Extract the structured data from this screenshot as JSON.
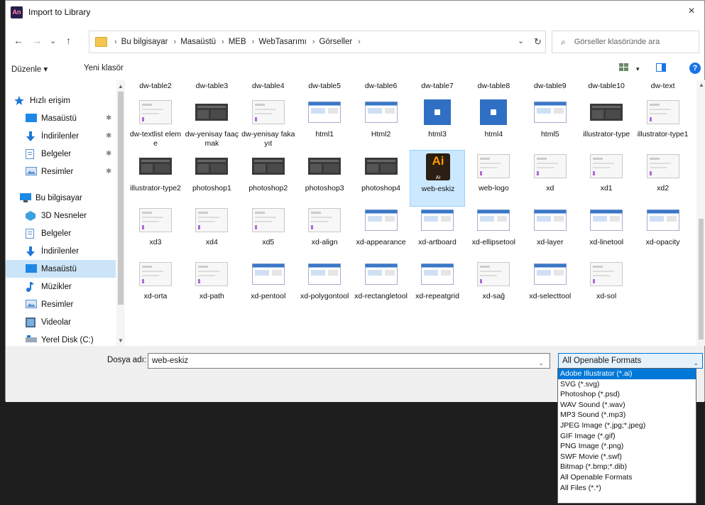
{
  "window": {
    "title": "Import to Library",
    "app_icon": "An",
    "close_label": "×"
  },
  "nav": {
    "back": "←",
    "forward": "→",
    "recent": "⌄",
    "up": "↑"
  },
  "address": {
    "crumbs": [
      "Bu bilgisayar",
      "Masaüstü",
      "MEB",
      "WebTasarımı",
      "Görseller"
    ],
    "separator": "›",
    "dropdown": "⌄",
    "refresh": "↻"
  },
  "search": {
    "icon": "⌕",
    "placeholder": "Görseller klasöründe ara"
  },
  "toolbar": {
    "organize": "Düzenle ▾",
    "new_folder": "Yeni klasör",
    "view_dropdown": "▾",
    "help": "?"
  },
  "sidebar": {
    "items": [
      {
        "label": "Hızlı erişim",
        "icon": "star-icon",
        "pinned": false,
        "selected": false
      },
      {
        "label": "Masaüstü",
        "icon": "desktop-icon",
        "pinned": true,
        "selected": false
      },
      {
        "label": "İndirilenler",
        "icon": "download-icon",
        "pinned": true,
        "selected": false
      },
      {
        "label": "Belgeler",
        "icon": "document-icon",
        "pinned": true,
        "selected": false
      },
      {
        "label": "Resimler",
        "icon": "pictures-icon",
        "pinned": true,
        "selected": false
      },
      {
        "label": "Bu bilgisayar",
        "icon": "computer-icon",
        "pinned": false,
        "selected": false
      },
      {
        "label": "3D Nesneler",
        "icon": "3d-objects-icon",
        "pinned": false,
        "selected": false
      },
      {
        "label": "Belgeler",
        "icon": "document-icon",
        "pinned": false,
        "selected": false
      },
      {
        "label": "İndirilenler",
        "icon": "download-icon",
        "pinned": false,
        "selected": false
      },
      {
        "label": "Masaüstü",
        "icon": "desktop-icon",
        "pinned": false,
        "selected": true
      },
      {
        "label": "Müzikler",
        "icon": "music-icon",
        "pinned": false,
        "selected": false
      },
      {
        "label": "Resimler",
        "icon": "pictures-icon",
        "pinned": false,
        "selected": false
      },
      {
        "label": "Videolar",
        "icon": "video-icon",
        "pinned": false,
        "selected": false
      },
      {
        "label": "Yerel Disk (C:)",
        "icon": "disk-icon",
        "pinned": false,
        "selected": false
      }
    ]
  },
  "files": {
    "top_row": [
      "dw-table2",
      "dw-table3",
      "dw-table4",
      "dw-table5",
      "dw-table6",
      "dw-table7",
      "dw-table8",
      "dw-table9",
      "dw-table10",
      "dw-text"
    ],
    "rows": [
      [
        {
          "name": "dw-textlist eleme",
          "thumb": "light"
        },
        {
          "name": "dw-yenisay faaçmak",
          "thumb": "dark"
        },
        {
          "name": "dw-yenisay fakayıt",
          "thumb": "light"
        },
        {
          "name": "html1",
          "thumb": "blue-window"
        },
        {
          "name": "Html2",
          "thumb": "blue-window"
        },
        {
          "name": "html3",
          "thumb": "blue"
        },
        {
          "name": "html4",
          "thumb": "blue"
        },
        {
          "name": "html5",
          "thumb": "blue-window"
        },
        {
          "name": "illustrator-type",
          "thumb": "dark"
        },
        {
          "name": "illustrator-type1",
          "thumb": "light"
        }
      ],
      [
        {
          "name": "illustrator-type2",
          "thumb": "dark"
        },
        {
          "name": "photoshop1",
          "thumb": "dark"
        },
        {
          "name": "photoshop2",
          "thumb": "dark"
        },
        {
          "name": "photoshop3",
          "thumb": "dark"
        },
        {
          "name": "photoshop4",
          "thumb": "dark"
        },
        {
          "name": "web-eskiz",
          "thumb": "ai",
          "selected": true
        },
        {
          "name": "web-logo",
          "thumb": "light"
        },
        {
          "name": "xd",
          "thumb": "light"
        },
        {
          "name": "xd1",
          "thumb": "light"
        },
        {
          "name": "xd2",
          "thumb": "light"
        }
      ],
      [
        {
          "name": "xd3",
          "thumb": "light"
        },
        {
          "name": "xd4",
          "thumb": "light"
        },
        {
          "name": "xd5",
          "thumb": "light"
        },
        {
          "name": "xd-align",
          "thumb": "light"
        },
        {
          "name": "xd-appearance",
          "thumb": "blue-window"
        },
        {
          "name": "xd-artboard",
          "thumb": "blue-window"
        },
        {
          "name": "xd-ellipsetool",
          "thumb": "blue-window"
        },
        {
          "name": "xd-layer",
          "thumb": "blue-window"
        },
        {
          "name": "xd-linetool",
          "thumb": "blue-window"
        },
        {
          "name": "xd-opacity",
          "thumb": "blue-window"
        }
      ],
      [
        {
          "name": "xd-orta",
          "thumb": "light"
        },
        {
          "name": "xd-path",
          "thumb": "light"
        },
        {
          "name": "xd-pentool",
          "thumb": "blue-window"
        },
        {
          "name": "xd-polygontool",
          "thumb": "blue-window"
        },
        {
          "name": "xd-rectangletool",
          "thumb": "blue-window"
        },
        {
          "name": "xd-repeatgrid",
          "thumb": "blue-window"
        },
        {
          "name": "xd-sağ",
          "thumb": "light"
        },
        {
          "name": "xd-selecttool",
          "thumb": "blue-window"
        },
        {
          "name": "xd-sol",
          "thumb": "light"
        }
      ]
    ],
    "ai_icon_text": "Ai",
    "ai_icon_sub": "AI"
  },
  "bottom": {
    "filename_label": "Dosya adı:",
    "filename_value": "web-eskiz",
    "format_selected": "All Openable Formats",
    "format_options": [
      "Adobe Illustrator (*.ai)",
      "SVG (*.svg)",
      "Photoshop (*.psd)",
      "WAV Sound (*.wav)",
      "MP3 Sound (*.mp3)",
      "JPEG Image (*.jpg;*.jpeg)",
      "GIF Image (*.gif)",
      "PNG Image (*.png)",
      "SWF Movie (*.swf)",
      "Bitmap (*.bmp;*.dib)",
      "All Openable Formats",
      "All Files (*.*)"
    ],
    "highlighted_option": 0
  },
  "colors": {
    "selection": "#cce4f7",
    "accent": "#0078d7",
    "folder": "#f3c652",
    "ai_bg": "#2b1e12",
    "ai_fg": "#ff9a00"
  }
}
